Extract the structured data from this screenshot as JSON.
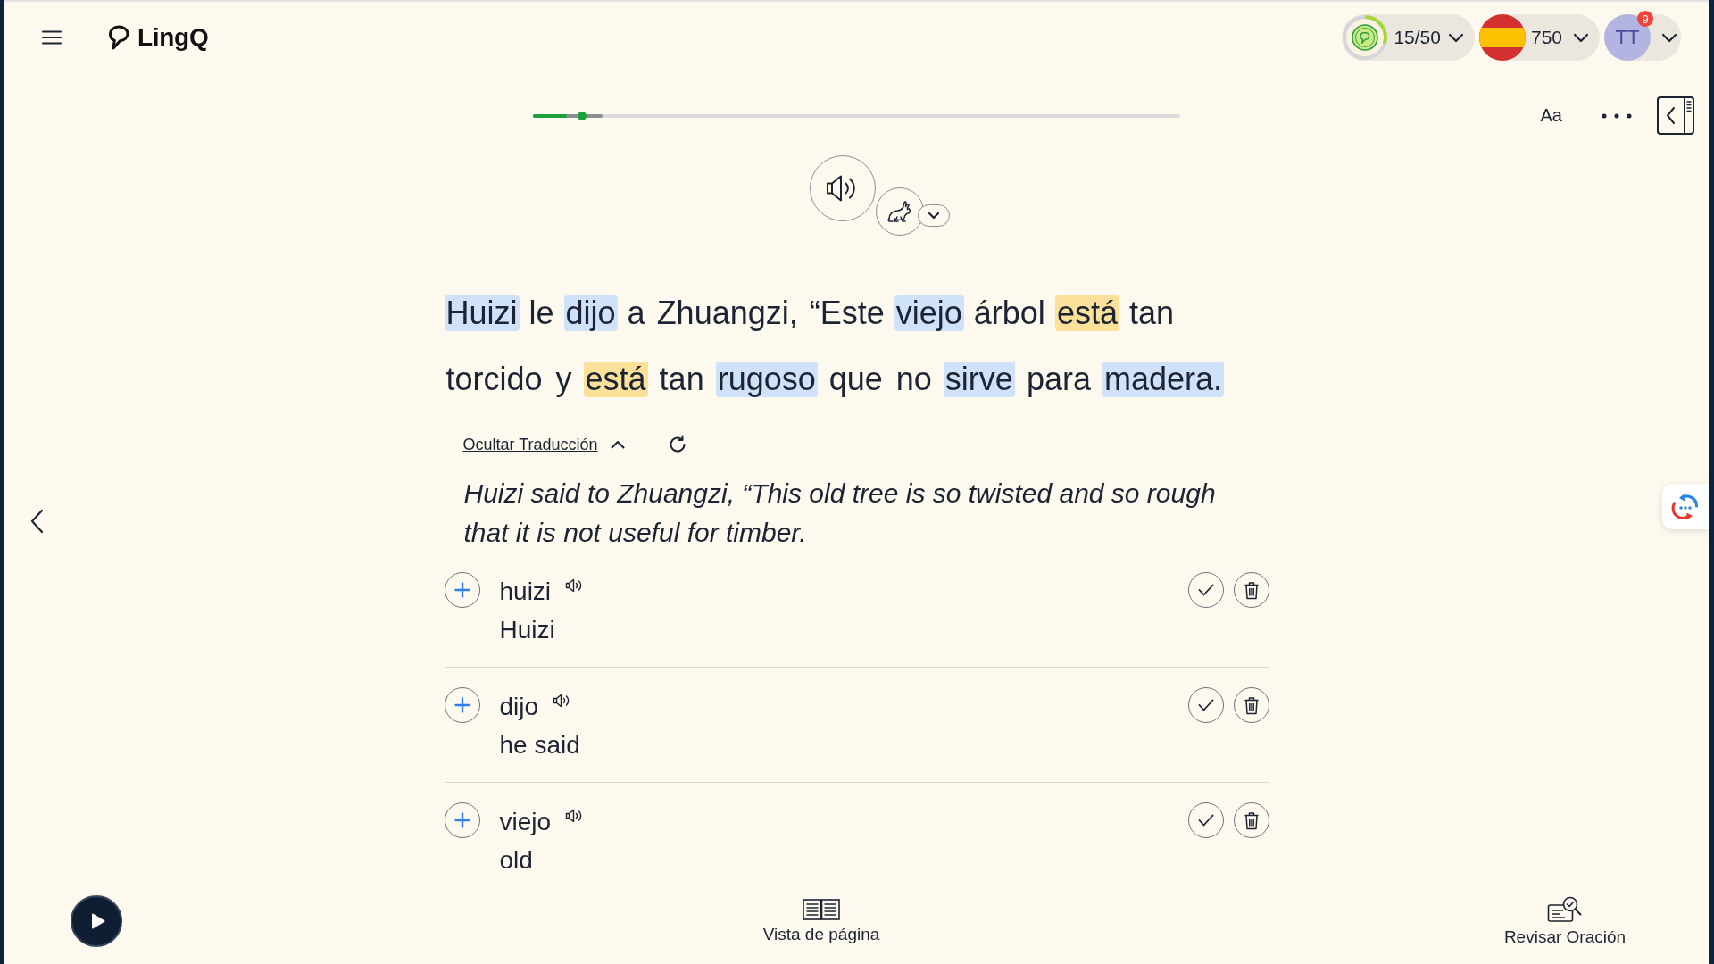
{
  "header": {
    "logo": "LingQ",
    "stats": {
      "count": "15/50",
      "level": 0.3
    },
    "language": {
      "score": "750"
    },
    "user": {
      "initials": "TT",
      "notifications": "9"
    }
  },
  "reader_toolbar": {
    "progress": {
      "read": {
        "level": 0.052
      },
      "page": {
        "level": 0.108
      },
      "position": {
        "level": 0.076
      }
    },
    "font_button": "Aa"
  },
  "sentence": {
    "lines": [
      [
        {
          "text": "Huizi",
          "kind": "new"
        },
        {
          "text": "le",
          "kind": "known"
        },
        {
          "text": "dijo",
          "kind": "new"
        },
        {
          "text": "a",
          "kind": "known"
        },
        {
          "text": "Zhuangzi,",
          "kind": "known"
        },
        {
          "text": "“Este",
          "kind": "known"
        },
        {
          "text": "viejo",
          "kind": "new"
        },
        {
          "text": "árbol",
          "kind": "known"
        },
        {
          "text": "está",
          "kind": "lingq"
        },
        {
          "text": "tan",
          "kind": "known"
        }
      ],
      [
        {
          "text": "torcido",
          "kind": "known"
        },
        {
          "text": "y",
          "kind": "known"
        },
        {
          "text": "está",
          "kind": "lingq"
        },
        {
          "text": "tan",
          "kind": "known"
        },
        {
          "text": "rugoso",
          "kind": "new"
        },
        {
          "text": "que",
          "kind": "known"
        },
        {
          "text": "no",
          "kind": "known"
        },
        {
          "text": "sirve",
          "kind": "new"
        },
        {
          "text": "para",
          "kind": "known"
        },
        {
          "text": "madera.",
          "kind": "new"
        }
      ]
    ]
  },
  "translation": {
    "toggle": "Ocultar Traducción",
    "expanded": true,
    "text": "Huizi said to Zhuangzi, “This old tree is so twisted and so rough that it is not useful for timber."
  },
  "words": [
    {
      "term": "huizi",
      "meaning": "Huizi"
    },
    {
      "term": "dijo",
      "meaning": "he said"
    },
    {
      "term": "viejo",
      "meaning": "old"
    }
  ],
  "bottom_bar": {
    "page_view": "Vista de página",
    "review": "Revisar Oración"
  }
}
